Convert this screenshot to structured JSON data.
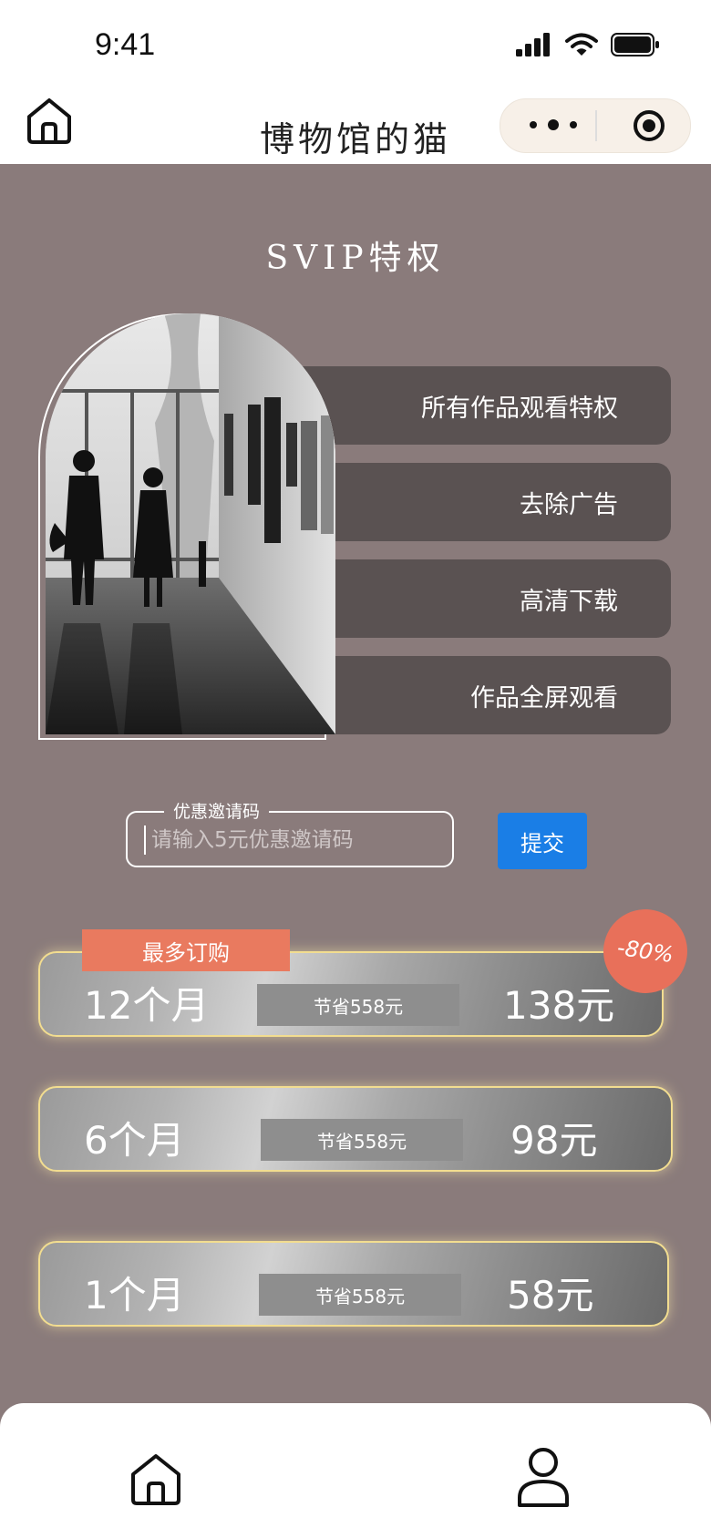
{
  "status": {
    "time": "9:41"
  },
  "nav": {
    "title": "博物馆的猫"
  },
  "section": {
    "title": "SVIP特权"
  },
  "benefits": [
    {
      "label": "所有作品观看特权"
    },
    {
      "label": "去除广告"
    },
    {
      "label": "高清下载"
    },
    {
      "label": "作品全屏观看"
    }
  ],
  "invite": {
    "label": "优惠邀请码",
    "placeholder": "请输入5元优惠邀请码",
    "submit_label": "提交"
  },
  "plans": [
    {
      "name": "12个月",
      "save": "节省558元",
      "price": "138元",
      "tag": "最多订购",
      "discount": "-80%"
    },
    {
      "name": "6个月",
      "save": "节省558元",
      "price": "98元"
    },
    {
      "name": "1个月",
      "save": "节省558元",
      "price": "58元"
    }
  ],
  "colors": {
    "accent": "#1a7ee6",
    "background": "#8a7b7b",
    "tag": "#e97a5f",
    "benefit_bg": "#5a5252"
  },
  "icons": {
    "home": "home-icon",
    "user": "user-icon",
    "more": "more-dots-icon",
    "target": "target-icon"
  }
}
